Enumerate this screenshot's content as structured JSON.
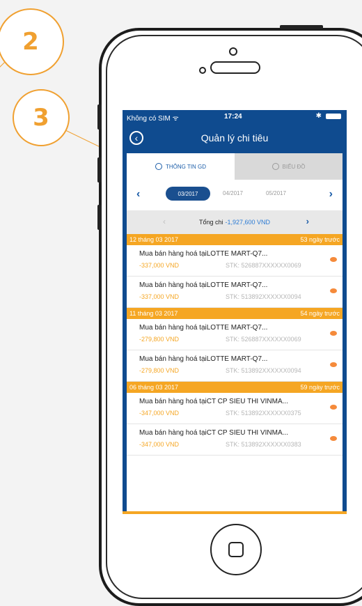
{
  "callouts": {
    "c2": "2",
    "c3": "3"
  },
  "status": {
    "carrier": "Không có SIM ᯤ",
    "time": "17:24",
    "bluetooth": "✱"
  },
  "nav": {
    "title": "Quản lý chi tiêu",
    "back_icon": "back-circle-icon"
  },
  "tabs": [
    {
      "label": "THÔNG TIN GD",
      "active": true
    },
    {
      "label": "BIỂU ĐỒ",
      "active": false
    }
  ],
  "months": {
    "prev": "‹",
    "selected": "03/2017",
    "m2": "04/2017",
    "m3": "05/2017",
    "next": "›"
  },
  "total": {
    "label": "Tổng chi",
    "value": "-1,927,600 VND",
    "left_arrow": "‹",
    "right_arrow": "›"
  },
  "groups": [
    {
      "date": "12 tháng 03 2017",
      "ago": "53 ngày trước",
      "items": [
        {
          "desc": "Mua bán hàng hoá tạiLOTTE MART-Q7...",
          "amount": "-337,000 VND",
          "account": "STK: 526887XXXXXX0069"
        },
        {
          "desc": "Mua bán hàng hoá tạiLOTTE MART-Q7...",
          "amount": "-337,000 VND",
          "account": "STK: 513892XXXXXX0094"
        }
      ]
    },
    {
      "date": "11 tháng 03 2017",
      "ago": "54 ngày trước",
      "items": [
        {
          "desc": "Mua bán hàng hoá tạiLOTTE MART-Q7...",
          "amount": "-279,800 VND",
          "account": "STK: 526887XXXXXX0069"
        },
        {
          "desc": "Mua bán hàng hoá tạiLOTTE MART-Q7...",
          "amount": "-279,800 VND",
          "account": "STK: 513892XXXXXX0094"
        }
      ]
    },
    {
      "date": "06 tháng 03 2017",
      "ago": "59 ngày trước",
      "items": [
        {
          "desc": "Mua bán hàng hoá tạiCT CP SIEU THI VINMA...",
          "amount": "-347,000 VND",
          "account": "STK: 513892XXXXXX0375"
        },
        {
          "desc": "Mua bán hàng hoá tạiCT CP SIEU THI VINMA...",
          "amount": "-347,000 VND",
          "account": "STK: 513892XXXXXX0383"
        }
      ]
    }
  ],
  "colors": {
    "brand": "#0f4b8f",
    "accent": "#f5a623",
    "callout": "#f0a030"
  }
}
